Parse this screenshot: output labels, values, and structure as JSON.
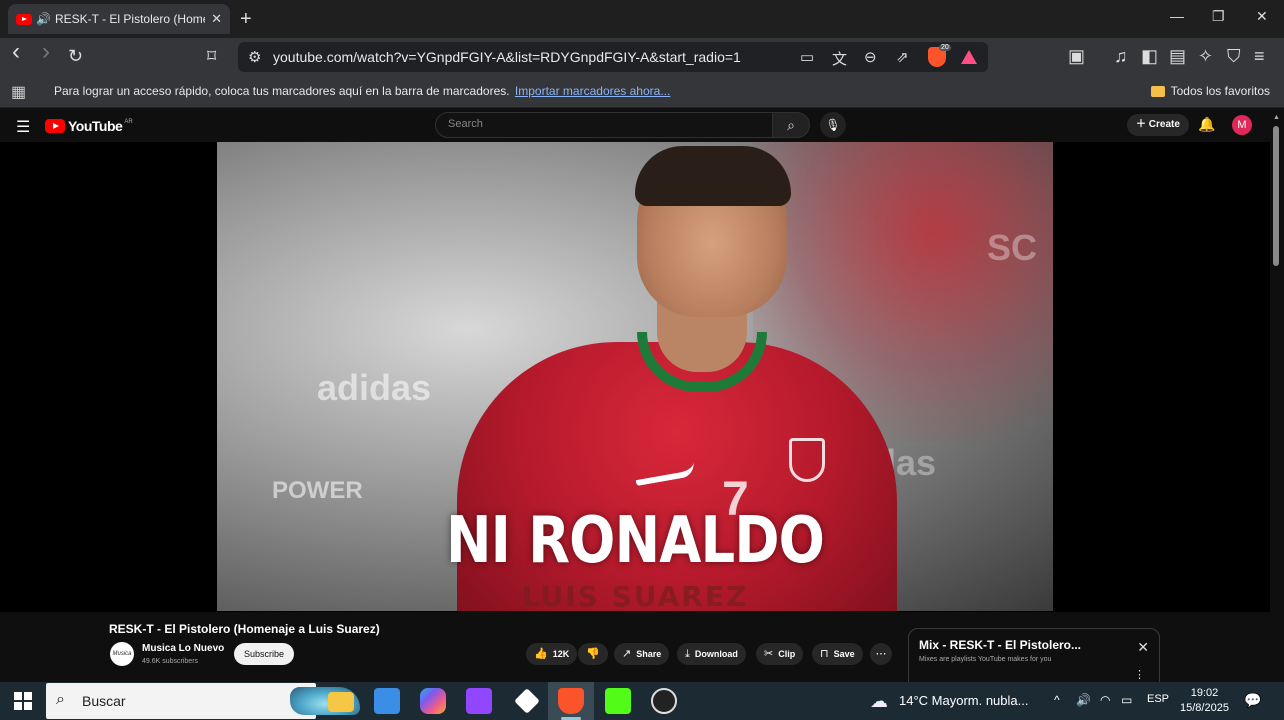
{
  "browser": {
    "tab": {
      "title": "RESK-T - El Pistolero (Homenaje a Luis Suarez)",
      "close": "✕"
    },
    "new_tab": "+",
    "window_controls": {
      "minimize": "—",
      "maximize": "❐",
      "close": "✕"
    },
    "toolbar": {
      "back": "‹",
      "forward": "›",
      "reload": "↻",
      "bookmark": "⊓",
      "url": "youtube.com/watch?v=YGnpdFGIY-A&list=RDYGnpdFGIY-A&start_radio=1",
      "brave_badge": "20",
      "icons": [
        "site-info-icon",
        "cast-icon",
        "translate-icon",
        "zoom-icon",
        "share-icon",
        "brave-shields-icon",
        "brave-rewards-icon",
        "reader-icon",
        "media-icon",
        "sidebar-icon",
        "wallet-icon",
        "leo-icon",
        "vpn-icon",
        "menu-icon"
      ]
    },
    "bookmarks_bar": {
      "message": "Para lograr un acceso rápido, coloca tus marcadores aquí en la barra de marcadores.",
      "import_link": "Importar marcadores ahora...",
      "all_favorites": "Todos los favoritos"
    }
  },
  "youtube": {
    "logo": "YouTube",
    "logo_region": "AR",
    "search_placeholder": "Search",
    "create_label": "Create",
    "avatar_letter": "M",
    "video": {
      "overlay_text": "NI RONALDO",
      "overlay_subtext": "LUIS SUAREZ",
      "jersey_number": "7",
      "background_logos": [
        "adidas",
        "POWER",
        "adidas",
        "SC"
      ]
    },
    "title": "RESK-T - El Pistolero (Homenaje a Luis Suarez)",
    "channel": {
      "name": "Musica Lo Nuevo",
      "subscribers": "49.6K subscribers",
      "avatar_text": "Musica"
    },
    "subscribe_label": "Subscribe",
    "actions": {
      "likes": "12K",
      "share": "Share",
      "download": "Download",
      "clip": "Clip",
      "save": "Save"
    },
    "mix": {
      "title": "Mix - RESK-T - El Pistolero...",
      "subtitle": "Mixes are playlists YouTube makes for you"
    }
  },
  "taskbar": {
    "search_text": "Buscar",
    "apps": [
      "file-explorer",
      "microsoft-store",
      "copilot",
      "twitch",
      "git",
      "brave",
      "kick",
      "obs"
    ],
    "weather": "14°C  Mayorm. nubla...",
    "language": "ESP",
    "time": "19:02",
    "date": "15/8/2025"
  },
  "colors": {
    "youtube_red": "#ff0000",
    "brave_orange": "#fb542b",
    "taskbar": "#1c2b33",
    "link": "#8ab4f8"
  }
}
